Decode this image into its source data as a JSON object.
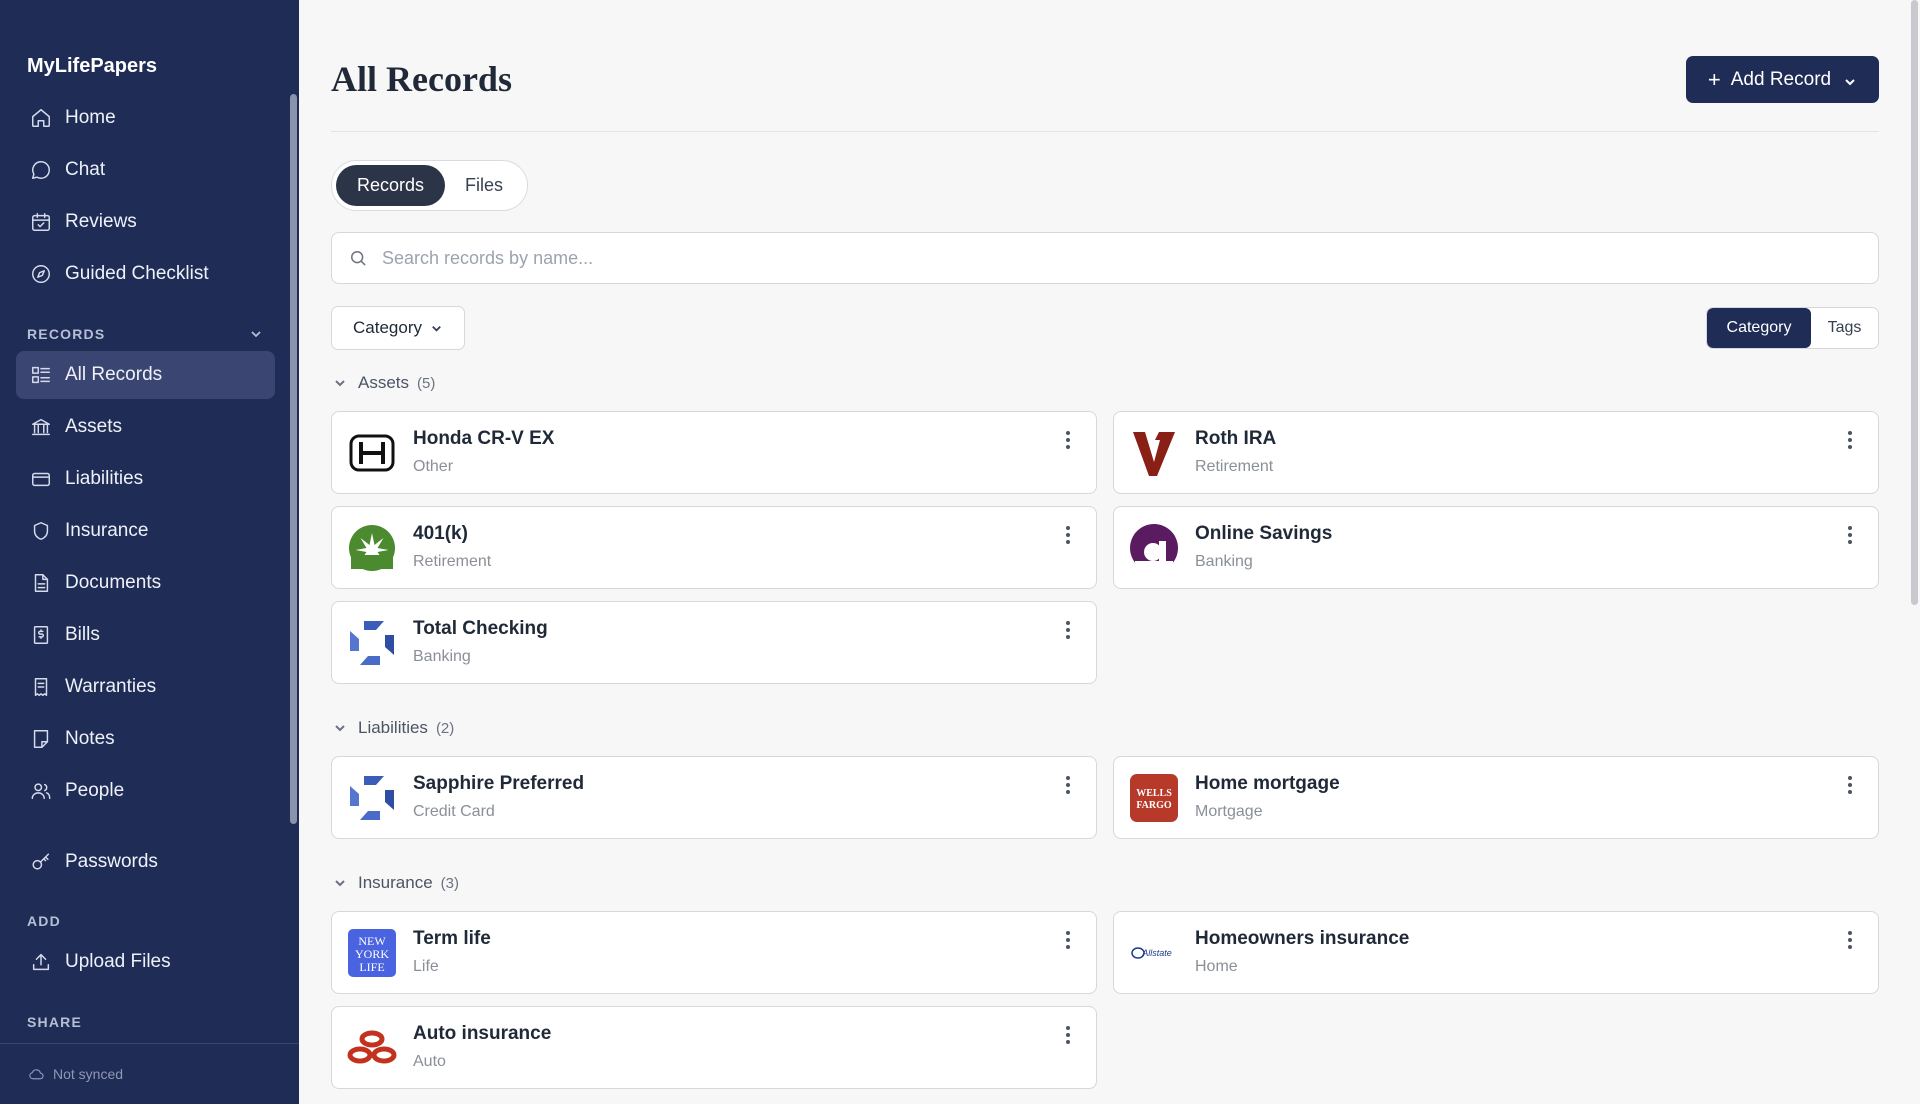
{
  "app": {
    "brand": "MyLifePapers"
  },
  "sidebar": {
    "nav": [
      {
        "label": "Home",
        "icon": "home-icon"
      },
      {
        "label": "Chat",
        "icon": "chat-icon"
      },
      {
        "label": "Reviews",
        "icon": "calendar-check-icon"
      },
      {
        "label": "Guided Checklist",
        "icon": "compass-icon"
      }
    ],
    "records_label": "RECORDS",
    "records": [
      {
        "label": "All Records",
        "icon": "list-grid-icon",
        "active": true
      },
      {
        "label": "Assets",
        "icon": "bank-icon"
      },
      {
        "label": "Liabilities",
        "icon": "credit-card-icon"
      },
      {
        "label": "Insurance",
        "icon": "shield-icon"
      },
      {
        "label": "Documents",
        "icon": "document-icon"
      },
      {
        "label": "Bills",
        "icon": "dollar-receipt-icon"
      },
      {
        "label": "Warranties",
        "icon": "receipt-icon"
      },
      {
        "label": "Notes",
        "icon": "note-icon"
      },
      {
        "label": "People",
        "icon": "people-icon"
      }
    ],
    "passwords": {
      "label": "Passwords",
      "icon": "key-icon"
    },
    "add_label": "ADD",
    "upload": {
      "label": "Upload Files",
      "icon": "upload-icon"
    },
    "share_label": "SHARE",
    "sync_status": "Not synced"
  },
  "header": {
    "title": "All Records",
    "add_button": "Add Record"
  },
  "tabs": {
    "records": "Records",
    "files": "Files",
    "selected": "Records"
  },
  "search": {
    "placeholder": "Search records by name...",
    "value": ""
  },
  "filter": {
    "category_label": "Category"
  },
  "view_toggle": {
    "category": "Category",
    "tags": "Tags",
    "selected": "Category"
  },
  "groups": [
    {
      "name": "Assets",
      "count": "(5)",
      "items": [
        {
          "title": "Honda CR-V EX",
          "subtitle": "Other",
          "logo": "honda-logo"
        },
        {
          "title": "Roth IRA",
          "subtitle": "Retirement",
          "logo": "vanguard-logo"
        },
        {
          "title": "401(k)",
          "subtitle": "Retirement",
          "logo": "fidelity-logo"
        },
        {
          "title": "Online Savings",
          "subtitle": "Banking",
          "logo": "ally-logo"
        },
        {
          "title": "Total Checking",
          "subtitle": "Banking",
          "logo": "chase-logo"
        }
      ]
    },
    {
      "name": "Liabilities",
      "count": "(2)",
      "items": [
        {
          "title": "Sapphire Preferred",
          "subtitle": "Credit Card",
          "logo": "chase-logo"
        },
        {
          "title": "Home mortgage",
          "subtitle": "Mortgage",
          "logo": "wells-fargo-logo",
          "logo_text": "WELLS FARGO"
        }
      ]
    },
    {
      "name": "Insurance",
      "count": "(3)",
      "items": [
        {
          "title": "Term life",
          "subtitle": "Life",
          "logo": "new-york-life-logo",
          "logo_text": "NEW YORK LIFE"
        },
        {
          "title": "Homeowners insurance",
          "subtitle": "Home",
          "logo": "allstate-logo",
          "logo_text": "Allstate"
        },
        {
          "title": "Auto insurance",
          "subtitle": "Auto",
          "logo": "state-farm-logo"
        }
      ]
    }
  ],
  "colors": {
    "sidebar_bg": "#1f2c56",
    "active_item": "#3a4671",
    "primary": "#1f2c56",
    "page_bg": "#f7f7f8"
  }
}
